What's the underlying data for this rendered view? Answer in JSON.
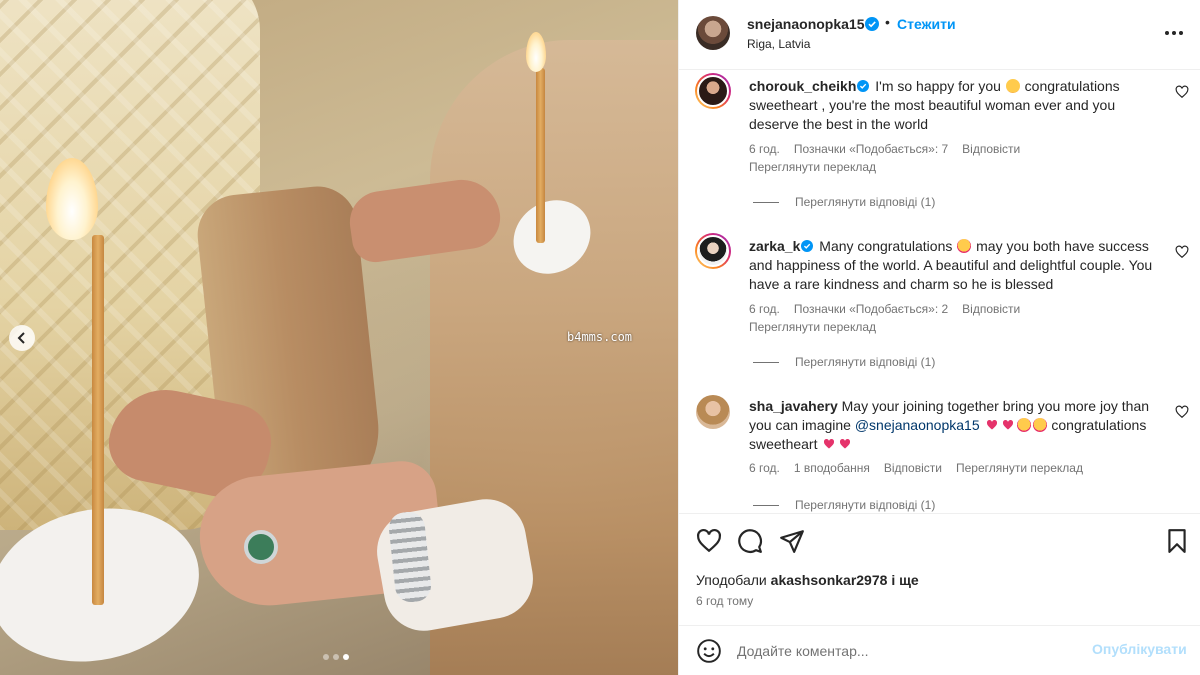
{
  "photo": {
    "watermark": "b4mms.com",
    "carousel_dots": 3,
    "active_dot": 2
  },
  "header": {
    "username": "snejanaonopka15",
    "separator": "•",
    "follow_label": "Стежити",
    "location": "Riga, Latvia"
  },
  "comments": [
    {
      "username": "chorouk_cheikh",
      "verified": true,
      "text_before": "I'm so happy for you",
      "emoji_after_1": "smiling-face-with-hearts",
      "text_after": " congratulations sweetheart , you're the most beautiful woman ever and you deserve the best in the world",
      "time": "6 год.",
      "likes": "Позначки «Подобається»: 7",
      "reply": "Відповісти",
      "translate": "Переглянути переклад",
      "view_replies": "Переглянути відповіді (1)"
    },
    {
      "username": "zarka_k",
      "verified": true,
      "text_before": "Many congratulations",
      "emoji_after_1": "heart-eyes",
      "text_after": " may you both have success and happiness of the world. A beautiful and delightful couple. You have a rare kindness and charm so he is blessed",
      "time": "6 год.",
      "likes": "Позначки «Подобається»: 2",
      "reply": "Відповісти",
      "translate": "Переглянути переклад",
      "view_replies": "Переглянути відповіді (1)"
    },
    {
      "username": "sha_javahery",
      "verified": false,
      "text_before": "May your joining together bring you more joy than you can imagine",
      "mention": "@snejanaonopka15",
      "text_tail": "congratulations sweetheart",
      "time": "6 год.",
      "likes": "1 вподобання",
      "reply": "Відповісти",
      "translate": "Переглянути переклад",
      "view_replies": "Переглянути відповіді (1)"
    }
  ],
  "actions": {
    "liked_by_prefix": "Уподобали",
    "liked_by_user": "akashsonkar2978",
    "liked_by_suffix": "і ще",
    "time_ago": "6 год тому"
  },
  "comment_box": {
    "placeholder": "Додайте коментар...",
    "post_label": "Опублікувати"
  },
  "icons": {
    "verified": "verified-badge-icon",
    "like": "heart-icon",
    "comment": "comment-bubble-icon",
    "share": "paper-plane-icon",
    "save": "bookmark-icon",
    "emoji": "emoji-icon",
    "more": "more-horizontal-icon",
    "prev": "chevron-left-icon"
  },
  "colors": {
    "link_blue": "#0095f6",
    "verified_blue": "#0095f6",
    "secondary_text": "#737373",
    "post_disabled": "#b2dffc",
    "heart_emoji": "#e5336b"
  }
}
